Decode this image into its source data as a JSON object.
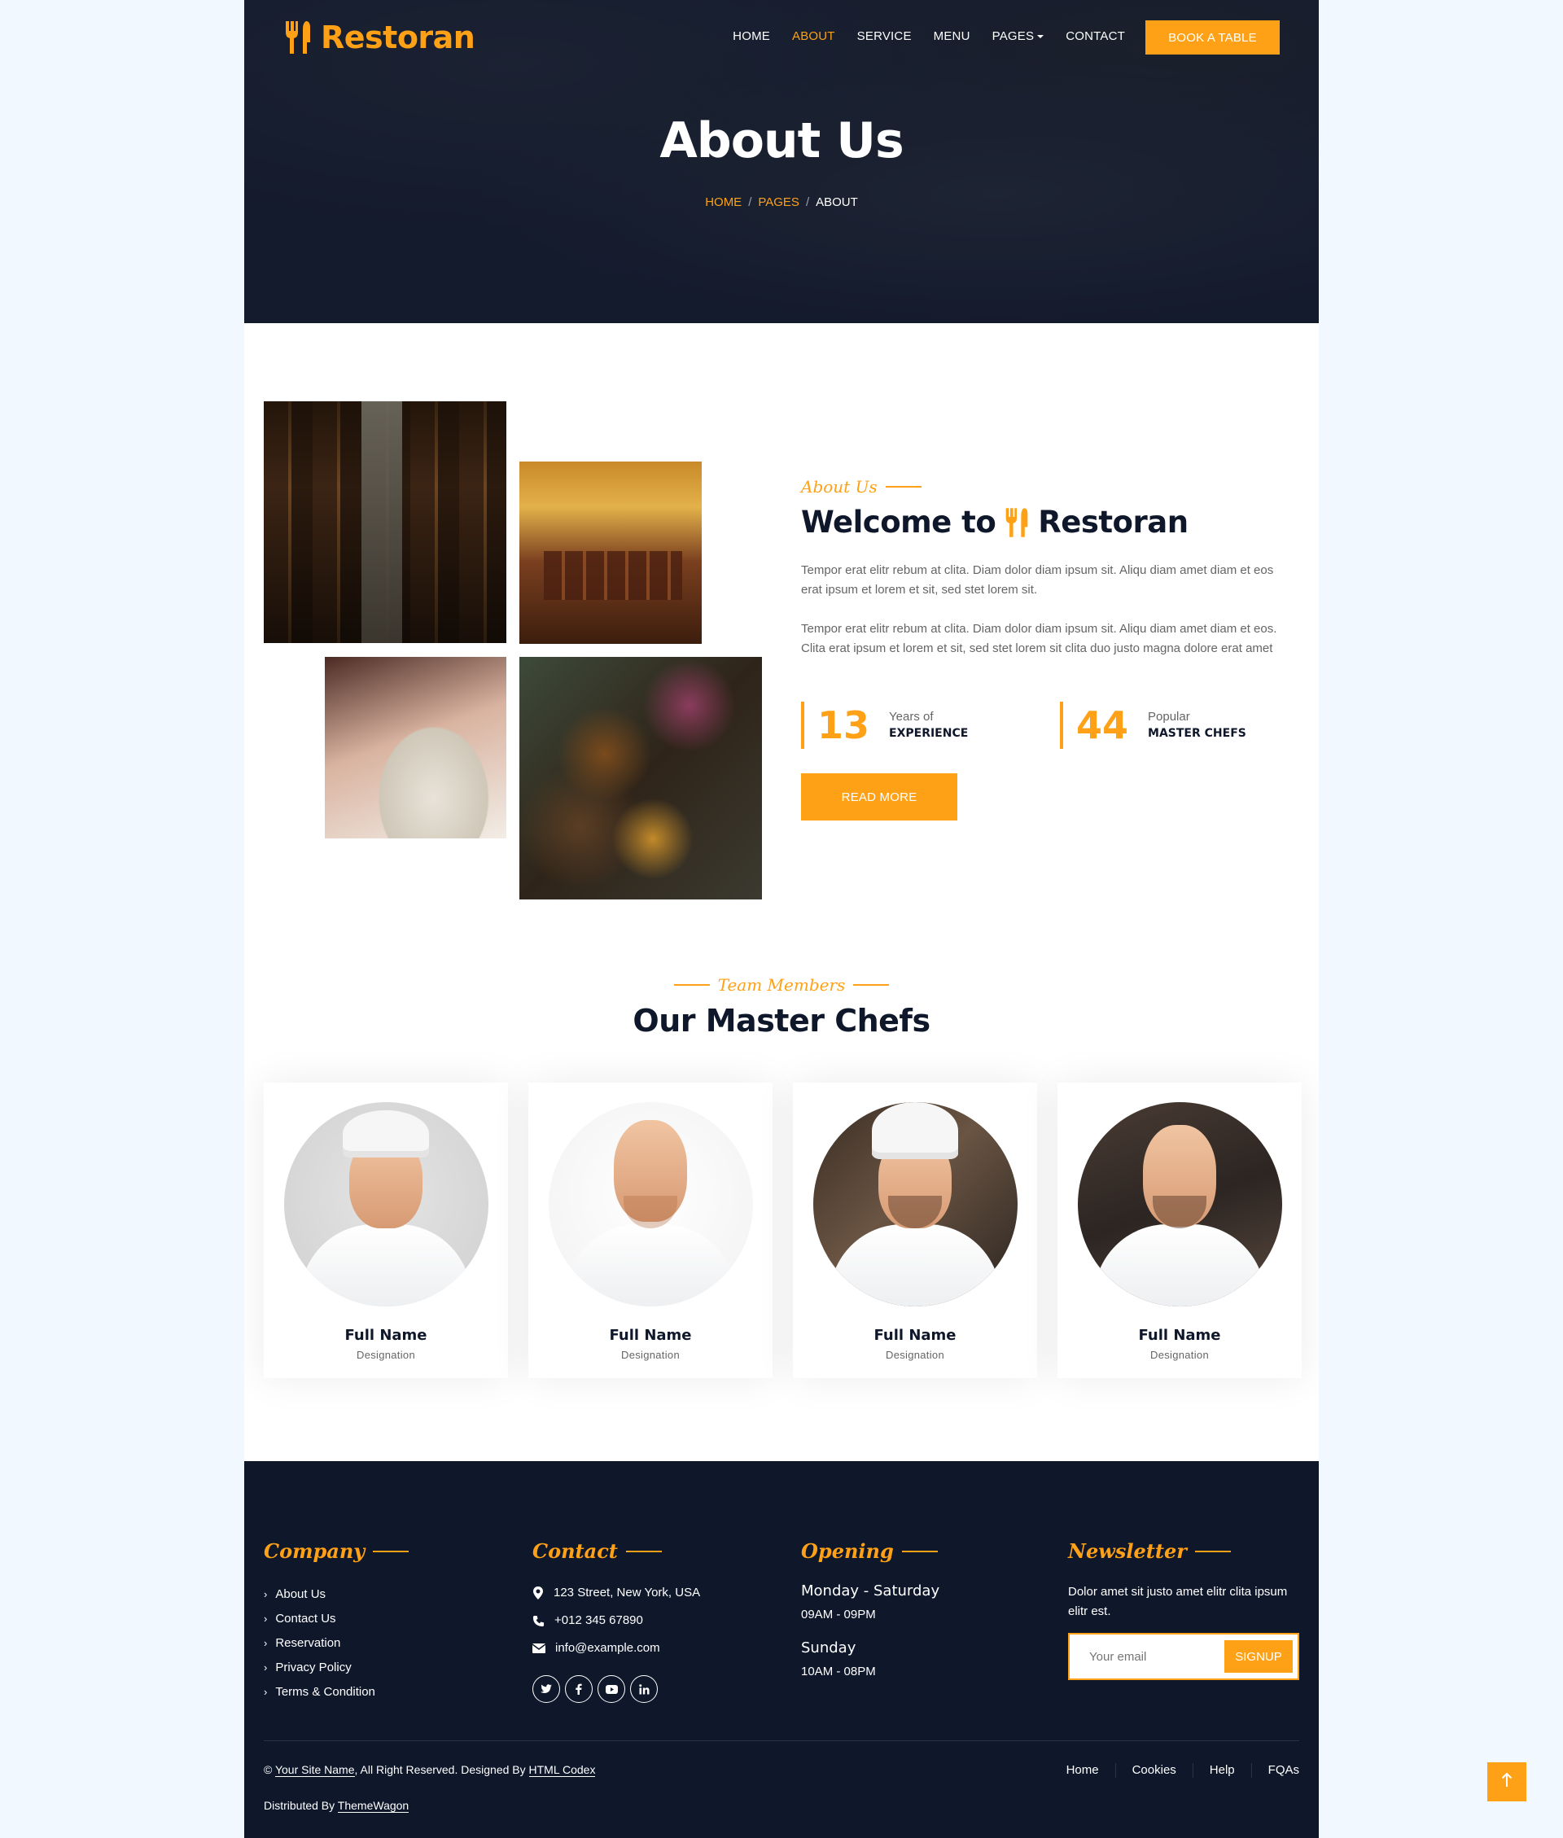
{
  "colors": {
    "accent": "#FEA116",
    "dark": "#0F172B",
    "text": "#666565",
    "page_bg": "#f1f8ff"
  },
  "brand": {
    "name": "Restoran",
    "icon": "utensils-icon"
  },
  "nav": {
    "items": [
      {
        "label": "HOME",
        "active": false
      },
      {
        "label": "ABOUT",
        "active": true
      },
      {
        "label": "SERVICE",
        "active": false
      },
      {
        "label": "MENU",
        "active": false
      },
      {
        "label": "PAGES",
        "active": false,
        "dropdown": true
      },
      {
        "label": "CONTACT",
        "active": false
      }
    ],
    "cta": "BOOK A TABLE"
  },
  "hero": {
    "title": "About Us",
    "breadcrumb": [
      "HOME",
      "PAGES",
      "ABOUT"
    ]
  },
  "about": {
    "tag": "About Us",
    "heading_before": "Welcome to",
    "heading_brand": "Restoran",
    "para1": "Tempor erat elitr rebum at clita. Diam dolor diam ipsum sit. Aliqu diam amet diam et eos erat ipsum et lorem et sit, sed stet lorem sit.",
    "para2": "Tempor erat elitr rebum at clita. Diam dolor diam ipsum sit. Aliqu diam amet diam et eos. Clita erat ipsum et lorem et sit, sed stet lorem sit clita duo justo magna dolore erat amet",
    "stats": [
      {
        "number": "13",
        "line1": "Years of",
        "line2": "EXPERIENCE"
      },
      {
        "number": "44",
        "line1": "Popular",
        "line2": "MASTER CHEFS"
      }
    ],
    "button": "READ MORE"
  },
  "team": {
    "tag": "Team Members",
    "title": "Our Master Chefs",
    "members": [
      {
        "name": "Full Name",
        "designation": "Designation"
      },
      {
        "name": "Full Name",
        "designation": "Designation"
      },
      {
        "name": "Full Name",
        "designation": "Designation"
      },
      {
        "name": "Full Name",
        "designation": "Designation"
      }
    ]
  },
  "footer": {
    "company": {
      "heading": "Company",
      "links": [
        "About Us",
        "Contact Us",
        "Reservation",
        "Privacy Policy",
        "Terms & Condition"
      ]
    },
    "contact": {
      "heading": "Contact",
      "address": "123 Street, New York, USA",
      "phone": "+012 345 67890",
      "email": "info@example.com",
      "socials": [
        "twitter-icon",
        "facebook-icon",
        "youtube-icon",
        "linkedin-icon"
      ]
    },
    "opening": {
      "heading": "Opening",
      "day1": "Monday - Saturday",
      "time1": "09AM - 09PM",
      "day2": "Sunday",
      "time2": "10AM - 08PM"
    },
    "newsletter": {
      "heading": "Newsletter",
      "text": "Dolor amet sit justo amet elitr clita ipsum elitr est.",
      "placeholder": "Your email",
      "button": "SIGNUP"
    },
    "copyright_prefix": "©",
    "site_name": "Your Site Name",
    "copyright_mid": ", All Right Reserved. Designed By",
    "designer": "HTML Codex",
    "distributed_prefix": "Distributed By",
    "distributor": "ThemeWagon",
    "nav": [
      "Home",
      "Cookies",
      "Help",
      "FQAs"
    ]
  },
  "back_to_top": "arrow-up-icon"
}
